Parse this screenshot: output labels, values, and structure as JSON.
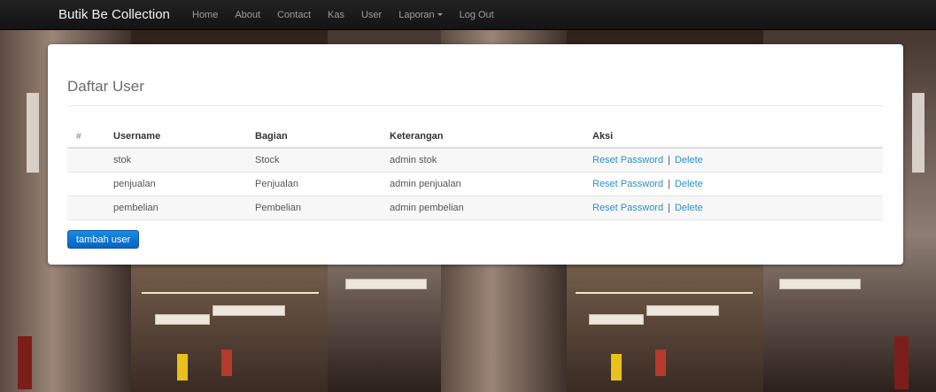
{
  "navbar": {
    "brand": "Butik Be Collection",
    "items": [
      "Home",
      "About",
      "Contact",
      "Kas",
      "User"
    ],
    "dropdown_label": "Laporan",
    "logout_label": "Log Out"
  },
  "panel": {
    "title": "Daftar User",
    "headers": [
      "#",
      "Username",
      "Bagian",
      "Keterangan",
      "Aksi"
    ],
    "rows": [
      {
        "username": "stok",
        "bagian": "Stock",
        "keterangan": "admin stok"
      },
      {
        "username": "penjualan",
        "bagian": "Penjualan",
        "keterangan": "admin penjualan"
      },
      {
        "username": "pembelian",
        "bagian": "Pembelian",
        "keterangan": "admin pembelian"
      }
    ],
    "reset_label": "Reset Password",
    "separator": "|",
    "delete_label": "Delete",
    "add_button": "tambah user"
  },
  "colors": {
    "navbar_bg": "#1b1b1b",
    "link": "#2a8fc8",
    "primary_button": "#0a6fd0"
  }
}
